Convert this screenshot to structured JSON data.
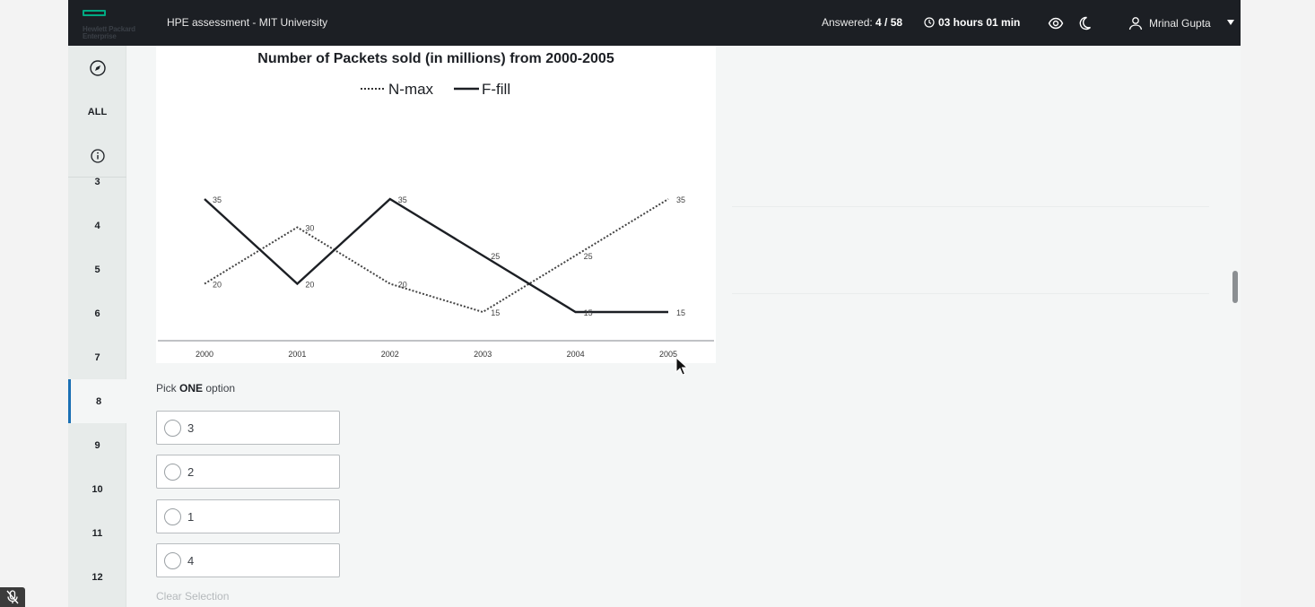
{
  "topbar": {
    "logo_text": "Hewlett Packard Enterprise",
    "title": "HPE assessment - MIT University",
    "answered_label": "Answered:",
    "answered_value": "4 / 58",
    "timer": "03 hours 01 min",
    "user_name": "Mrinal Gupta",
    "icons": [
      "hpe-logo-icon",
      "clock-icon",
      "eye-icon",
      "moon-icon",
      "user-icon",
      "caret-down-icon"
    ]
  },
  "sidebar": {
    "top_items": [
      "compass-icon",
      "ALL",
      "info-icon"
    ],
    "all_label": "ALL",
    "questions": [
      "3",
      "4",
      "5",
      "6",
      "7",
      "8",
      "9",
      "10",
      "11",
      "12"
    ],
    "active": "8"
  },
  "question": {
    "pick_prefix": "Pick",
    "pick_bold": "ONE",
    "pick_suffix": "option",
    "options": [
      "3",
      "2",
      "1",
      "4"
    ],
    "clear_label": "Clear Selection"
  },
  "colors": {
    "topbar": "#1c1f24",
    "accent": "#1a6fb4",
    "brand": "#01a982"
  },
  "chart_data": {
    "type": "line",
    "title": "Number of Packets sold (in millions) from 2000-2005",
    "categories": [
      "2000",
      "2001",
      "2002",
      "2003",
      "2004",
      "2005"
    ],
    "series": [
      {
        "name": "N-max",
        "style": "dotted",
        "values": [
          20,
          30,
          20,
          15,
          25,
          35
        ]
      },
      {
        "name": "F-fill",
        "style": "solid",
        "values": [
          35,
          20,
          35,
          25,
          15,
          15
        ]
      }
    ],
    "legend": "top-center",
    "grid": false
  }
}
